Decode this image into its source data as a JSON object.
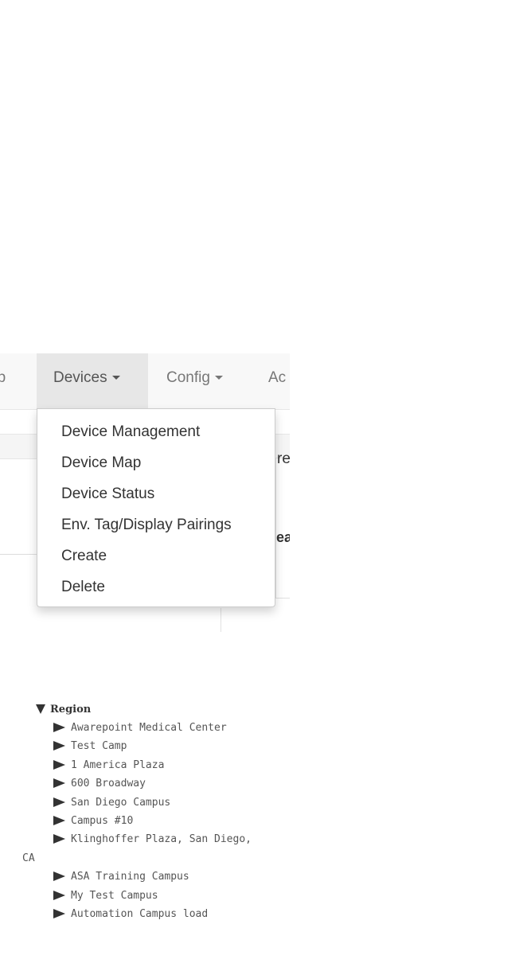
{
  "navbar": {
    "items": [
      {
        "label": "ap",
        "has_caret": false
      },
      {
        "label": "Devices",
        "has_caret": true,
        "active": true
      },
      {
        "label": "Config",
        "has_caret": true
      },
      {
        "label": "Ac",
        "has_caret": false
      }
    ]
  },
  "background_text": {
    "right_cell_1": "re",
    "right_cell_2": "ea"
  },
  "devices_menu": {
    "items": [
      "Device Management",
      "Device Map",
      "Device Status",
      "Env. Tag/Display Pairings",
      "Create",
      "Delete"
    ]
  },
  "region_tree": {
    "root_label": "Region",
    "items": [
      "Awarepoint Medical Center",
      "Test Camp",
      "1 America Plaza",
      "600 Broadway",
      "San Diego Campus",
      "Campus #10",
      "Klinghoffer Plaza, San Diego, CA",
      "ASA Training Campus",
      "My Test Campus",
      "Automation Campus load"
    ]
  },
  "colors": {
    "navbar_bg": "#f8f8f8",
    "navbar_active_bg": "#e7e7e7",
    "nav_text": "#777777",
    "menu_text": "#333333",
    "tree_text": "#555555"
  }
}
